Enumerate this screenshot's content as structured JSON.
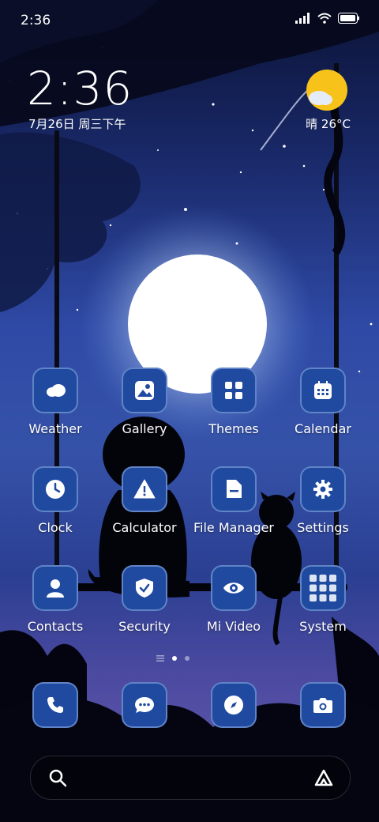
{
  "status_bar": {
    "time": "2:36"
  },
  "lock_widget": {
    "time": "2:36",
    "date": "7月26日 周三下午",
    "weather": "晴 26°C"
  },
  "apps": [
    {
      "label": "Weather",
      "icon": "weather-cloud-icon"
    },
    {
      "label": "Gallery",
      "icon": "gallery-image-icon"
    },
    {
      "label": "Themes",
      "icon": "themes-grid-icon"
    },
    {
      "label": "Calendar",
      "icon": "calendar-icon"
    },
    {
      "label": "Clock",
      "icon": "clock-icon"
    },
    {
      "label": "Calculator",
      "icon": "calculator-warning-icon"
    },
    {
      "label": "File Manager",
      "icon": "file-manager-icon"
    },
    {
      "label": "Settings",
      "icon": "gear-icon"
    },
    {
      "label": "Contacts",
      "icon": "contacts-person-icon"
    },
    {
      "label": "Security",
      "icon": "shield-check-icon"
    },
    {
      "label": "Mi Video",
      "icon": "eye-icon"
    },
    {
      "label": "System",
      "icon": "folder-grid-icon"
    }
  ],
  "dock": [
    {
      "icon": "phone-icon"
    },
    {
      "icon": "messages-icon"
    },
    {
      "icon": "compass-icon"
    },
    {
      "icon": "camera-icon"
    }
  ],
  "page_indicator": {
    "pages": 2,
    "current": 1
  },
  "colors": {
    "icon_bg": "#1f4aa0",
    "moon": "#ffffff",
    "sun": "#f7c31a"
  }
}
